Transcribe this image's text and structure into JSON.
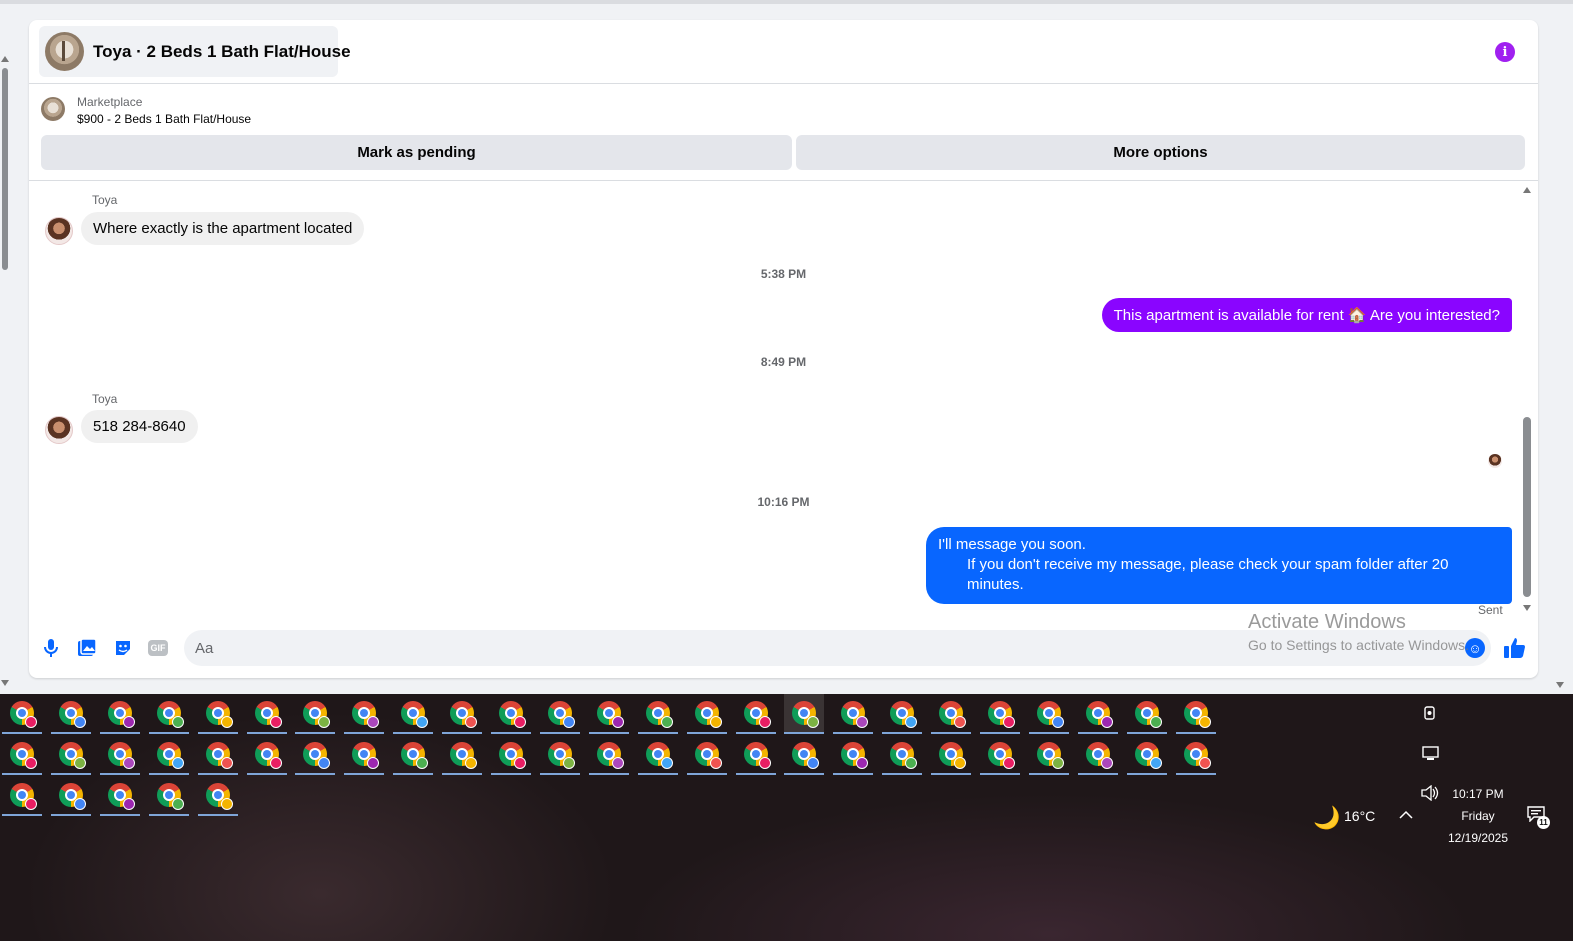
{
  "header": {
    "title": "Toya · 2 Beds 1 Bath Flat/House"
  },
  "listing": {
    "label": "Marketplace",
    "price_title": "$900 - 2 Beds 1 Bath Flat/House"
  },
  "actions": {
    "pending_label": "Mark as pending",
    "more_label": "More options"
  },
  "messages": {
    "msg1": {
      "sender": "Toya",
      "text": "Where exactly is the apartment located"
    },
    "time1": "5:38 PM",
    "msg2": {
      "text": "This apartment is available for rent 🏠 Are you interested?"
    },
    "time2": "8:49 PM",
    "msg3": {
      "sender": "Toya",
      "text": "518 284-8640"
    },
    "time3": "10:16 PM",
    "msg4": {
      "line1": "I'll message you soon.",
      "line2": "If you don't receive my message, please check your spam folder after 20 minutes."
    },
    "status": "Sent"
  },
  "composer": {
    "placeholder": "Aa",
    "gif_label": "GIF"
  },
  "watermark": {
    "title": "Activate Windows",
    "subtitle": "Go to Settings to activate Windows."
  },
  "taskbar": {
    "weather_temp": "16°C",
    "time": "10:17 PM",
    "day": "Friday",
    "date": "12/19/2025",
    "notification_count": "11"
  },
  "colors": {
    "accent_purple": "#8a05ff",
    "accent_blue": "#0866ff",
    "info_icon": "#a020f0"
  }
}
